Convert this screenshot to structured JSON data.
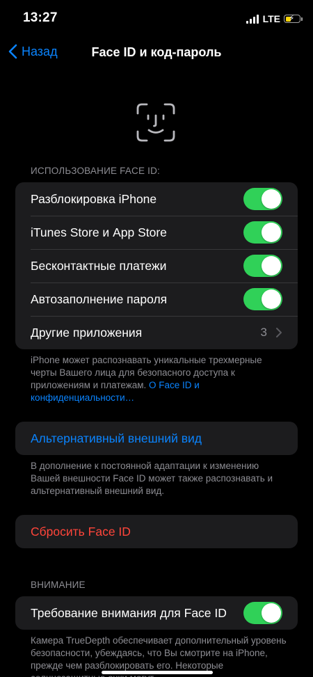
{
  "status_bar": {
    "time": "13:27",
    "network": "LTE"
  },
  "nav": {
    "back_label": "Назад",
    "title": "Face ID и код-пароль"
  },
  "face_id_section": {
    "header": "ИСПОЛЬЗОВАНИЕ FACE ID:",
    "rows": [
      {
        "label": "Разблокировка iPhone",
        "on": true
      },
      {
        "label": "iTunes Store и App Store",
        "on": true
      },
      {
        "label": "Бесконтактные платежи",
        "on": true
      },
      {
        "label": "Автозаполнение пароля",
        "on": true
      }
    ],
    "other_apps": {
      "label": "Другие приложения",
      "value": "3"
    },
    "footer_text": "iPhone может распознавать уникальные трехмерные черты Вашего лица для безопасного доступа к приложениям и платежам. ",
    "footer_link": "О Face ID и конфиденциальности…"
  },
  "alternate": {
    "label": "Альтернативный внешний вид",
    "footer": "В дополнение к постоянной адаптации к изменению Вашей внешности Face ID может также распознавать и альтернативный внешний вид."
  },
  "reset": {
    "label": "Сбросить Face ID"
  },
  "attention": {
    "header": "ВНИМАНИЕ",
    "label": "Требование внимания для Face ID",
    "on": true,
    "footer": "Камера TrueDepth обеспечивает дополнительный уровень безопасности, убеждаясь, что Вы смотрите на iPhone, прежде чем разблокировать его. Некоторые солнцезащитные очки могут"
  },
  "colors": {
    "accent": "#0a84ff",
    "toggle_on": "#30d158",
    "destructive": "#ff453a",
    "cell_bg": "#1c1c1e"
  }
}
